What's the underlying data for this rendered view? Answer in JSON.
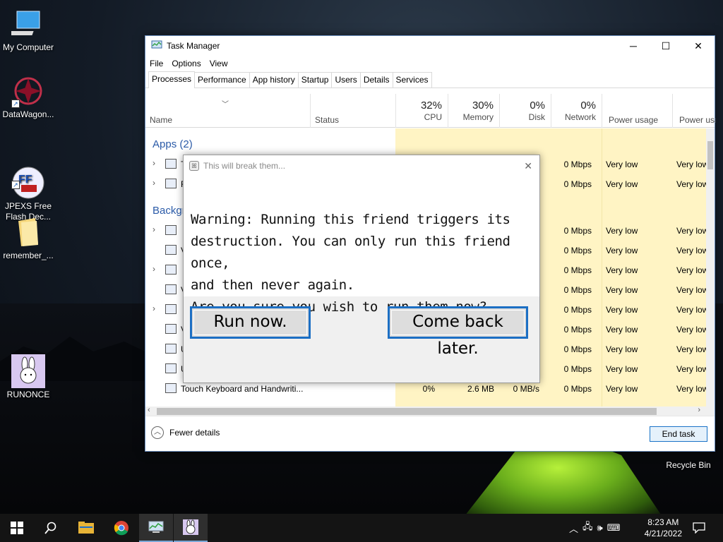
{
  "desktop": {
    "icons": [
      {
        "label": "My Computer"
      },
      {
        "label": "DataWagon..."
      },
      {
        "label": "JPEXS Free\nFlash Dec..."
      },
      {
        "label": "remember_..."
      },
      {
        "label": "RUNONCE"
      },
      {
        "label": "Recycle Bin"
      }
    ]
  },
  "task_manager": {
    "title": "Task Manager",
    "menu": [
      "File",
      "Options",
      "View"
    ],
    "tabs": [
      "Processes",
      "Performance",
      "App history",
      "Startup",
      "Users",
      "Details",
      "Services"
    ],
    "active_tab": "Processes",
    "columns": {
      "name": "Name",
      "status": "Status",
      "cpu": {
        "pct": "32%",
        "label": "CPU"
      },
      "memory": {
        "pct": "30%",
        "label": "Memory"
      },
      "disk": {
        "pct": "0%",
        "label": "Disk"
      },
      "network": {
        "pct": "0%",
        "label": "Network"
      },
      "power": "Power usage",
      "power_trend": "Power usa"
    },
    "groups": {
      "apps": "Apps (2)",
      "background": "Backgr"
    },
    "rows": [
      {
        "name": "T",
        "disk": "/s",
        "network": "0 Mbps",
        "power": "Very low",
        "trend": "Very low"
      },
      {
        "name": "F",
        "disk": "/s",
        "network": "0 Mbps",
        "power": "Very low",
        "trend": "Very low"
      },
      {
        "name": "",
        "disk": "/s",
        "network": "0 Mbps",
        "power": "Very low",
        "trend": "Very low"
      },
      {
        "name": "V",
        "disk": "/s",
        "network": "0 Mbps",
        "power": "Very low",
        "trend": "Very low"
      },
      {
        "name": "",
        "disk": "/s",
        "network": "0 Mbps",
        "power": "Very low",
        "trend": "Very low"
      },
      {
        "name": "V",
        "disk": "/s",
        "network": "0 Mbps",
        "power": "Very low",
        "trend": "Very low"
      },
      {
        "name": "",
        "disk": "/s",
        "network": "0 Mbps",
        "power": "Very low",
        "trend": "Very low"
      },
      {
        "name": "V",
        "disk": "/s",
        "network": "0 Mbps",
        "power": "Very low",
        "trend": "Very low"
      },
      {
        "name": "U",
        "disk": "/s",
        "network": "0 Mbps",
        "power": "Very low",
        "trend": "Very low"
      },
      {
        "name": "U",
        "disk": "/s",
        "network": "0 Mbps",
        "power": "Very low",
        "trend": "Very low"
      },
      {
        "name": "Touch Keyboard and Handwriti...",
        "cpu": "0%",
        "memory": "2.6 MB",
        "disk": "0 MB/s",
        "network": "0 Mbps",
        "power": "Very low",
        "trend": "Very low"
      }
    ],
    "footer": {
      "fewer_details": "Fewer details",
      "end_task": "End task"
    }
  },
  "dialog": {
    "title": "This will break them...",
    "message_lines": [
      "Warning: Running this friend triggers its",
      "destruction. You can only run this friend once,",
      "and then never again.",
      "Are you sure you wish to run them now?"
    ],
    "run_now": "Run now.",
    "come_back_later": "Come back later."
  },
  "taskbar": {
    "clock_time": "8:23 AM",
    "clock_date": "4/21/2022"
  }
}
